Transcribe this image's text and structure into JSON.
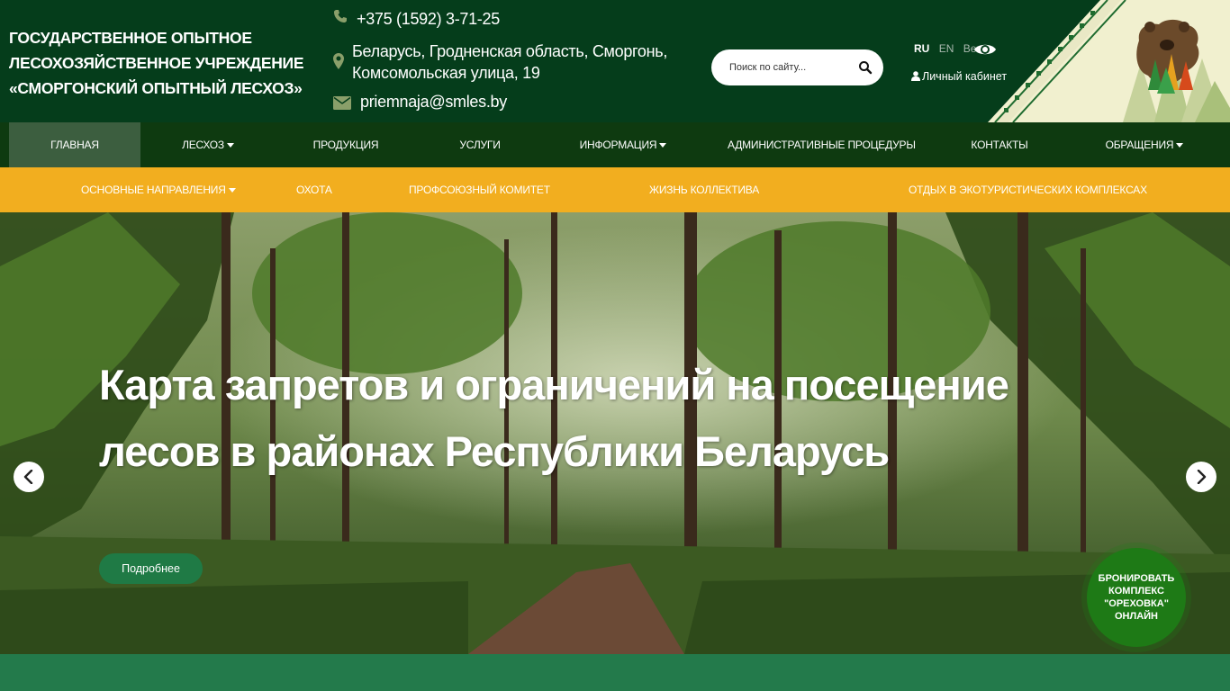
{
  "header": {
    "org_title_lines": [
      "ГОСУДАРСТВЕННОЕ ОПЫТНОЕ",
      "ЛЕСОХОЗЯЙСТВЕННОЕ УЧРЕЖДЕНИЕ",
      "«СМОРГОНСКИЙ ОПЫТНЫЙ ЛЕСХОЗ»"
    ],
    "phone": "+375 (1592) 3-71-25",
    "address_lines": [
      "Беларусь, Гродненская область, Сморгонь,",
      "Комсомольская улица, 19"
    ],
    "email": "priemnaja@smles.by",
    "search_placeholder": "Поиск по сайту...",
    "languages": [
      {
        "code": "RU",
        "active": true
      },
      {
        "code": "EN",
        "active": false
      },
      {
        "code": "Be",
        "active": false
      }
    ],
    "cabinet_label": "Личный кабинет"
  },
  "nav_main": [
    {
      "label": "ГЛАВНАЯ",
      "active": true,
      "dropdown": false
    },
    {
      "label": "ЛЕСХОЗ",
      "active": false,
      "dropdown": true
    },
    {
      "label": "ПРОДУКЦИЯ",
      "active": false,
      "dropdown": false
    },
    {
      "label": "УСЛУГИ",
      "active": false,
      "dropdown": false
    },
    {
      "label": "ИНФОРМАЦИЯ",
      "active": false,
      "dropdown": true
    },
    {
      "label": "АДМИНИСТРАТИВНЫЕ ПРОЦЕДУРЫ",
      "active": false,
      "dropdown": false
    },
    {
      "label": "КОНТАКТЫ",
      "active": false,
      "dropdown": false
    },
    {
      "label": "ОБРАЩЕНИЯ",
      "active": false,
      "dropdown": true
    }
  ],
  "nav_secondary": [
    {
      "label": "ОСНОВНЫЕ НАПРАВЛЕНИЯ",
      "dropdown": true
    },
    {
      "label": "ОХОТА",
      "dropdown": false
    },
    {
      "label": "ПРОФСОЮЗНЫЙ КОМИТЕТ",
      "dropdown": false
    },
    {
      "label": "ЖИЗНЬ КОЛЛЕКТИВА",
      "dropdown": false
    },
    {
      "label": "ОТДЫХ В ЭКОТУРИСТИЧЕСКИХ КОМПЛЕКСАХ",
      "dropdown": false
    }
  ],
  "hero": {
    "title_lines": [
      "Карта запретов и ограничений на посещение",
      "лесов в районах Республики Беларусь"
    ],
    "button_label": "Подробнее",
    "booking_label": "БРОНИРОВАТЬ КОМПЛЕКС \"ОРЕХОВКА\" ОНЛАЙН"
  },
  "colors": {
    "header_bg": "#053d1b",
    "nav_main_bg": "#0e3a10",
    "nav_secondary_bg": "#f2ae1f",
    "accent_green": "#1f7a45",
    "icon_green": "#8a9f6a"
  },
  "icons": {
    "phone": "phone-icon",
    "address": "map-marker-icon",
    "email": "envelope-icon",
    "search": "search-icon",
    "accessibility": "eye-icon",
    "cabinet": "user-icon",
    "prev": "chevron-left-icon",
    "next": "chevron-right-icon"
  }
}
